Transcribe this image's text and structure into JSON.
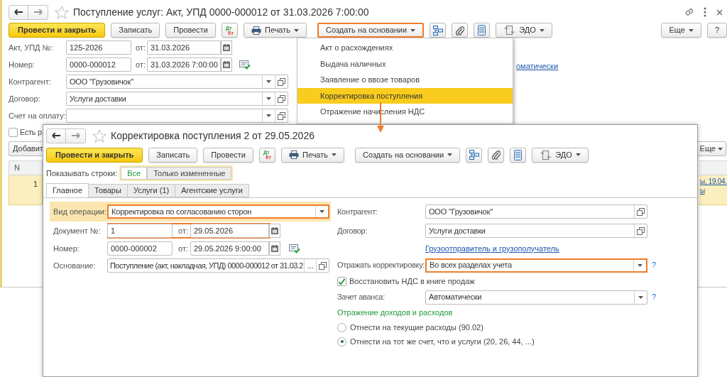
{
  "back_window": {
    "title": "Поступление услуг: Акт, УПД 0000-000012 от 31.03.2026 7:00:00",
    "toolbar": [
      {
        "kind": "primary",
        "label": "Провести и закрыть",
        "highlighted": false
      },
      {
        "kind": "button",
        "label": "Записать",
        "highlighted": false
      },
      {
        "kind": "button",
        "label": "Провести",
        "highlighted": false
      },
      {
        "kind": "dtkt",
        "top": "Дт",
        "bottom": "Кт",
        "highlighted": false
      },
      {
        "kind": "print",
        "label": "Печать",
        "highlighted": false
      },
      {
        "kind": "dropdown",
        "label": "Создать на основании",
        "highlighted": true
      },
      {
        "kind": "structure",
        "highlighted": false
      },
      {
        "kind": "attach",
        "highlighted": false
      },
      {
        "kind": "list",
        "highlighted": false
      },
      {
        "kind": "edo",
        "label": "ЭДО",
        "highlighted": false
      }
    ],
    "toolbar_right": [
      {
        "kind": "dropdown",
        "label": "Еще"
      },
      {
        "kind": "button",
        "label": "?"
      }
    ],
    "fields": [
      {
        "kind": "numbered",
        "label": "Акт, УПД №:",
        "value": "125-2026",
        "date_label": "от:",
        "date": "31.03.2026"
      },
      {
        "kind": "numbered_posted",
        "label": "Номер:",
        "value": "0000-000012",
        "date_label": "от:",
        "date": "31.03.2026  7:00:00"
      },
      {
        "kind": "select",
        "label": "Контрагент:",
        "value": "ООО \"Грузовичок\""
      },
      {
        "kind": "select",
        "label": "Договор:",
        "value": "Услуги доставки"
      },
      {
        "kind": "select",
        "label": "Счет на оплату:"
      }
    ],
    "link_fragment": "оматически",
    "checkbox": {
      "label": "Есть р",
      "checked": false
    },
    "table_toolbar": {
      "add": "Добавит",
      "more": "Еще"
    },
    "table": {
      "columns": [
        "N"
      ],
      "rows": [
        {
          "n": "1",
          "links": [
            "ы, 19.04.",
            "ы"
          ],
          "selected": true
        }
      ]
    },
    "menu": {
      "items": [
        {
          "label": "Акт о расхождениях",
          "selected": false
        },
        {
          "label": "Выдача наличных",
          "selected": false
        },
        {
          "label": "Заявление о ввозе товаров",
          "selected": false
        },
        {
          "label": "Корректировка поступления",
          "selected": true
        },
        {
          "label": "Отражение начисления НДС",
          "selected": false
        }
      ]
    }
  },
  "front_window": {
    "title": "Корректировка поступления 2 от 29.05.2026",
    "toolbar": [
      {
        "kind": "primary",
        "label": "Провести и закрыть"
      },
      {
        "kind": "button",
        "label": "Записать"
      },
      {
        "kind": "button",
        "label": "Провести"
      },
      {
        "kind": "dtkt",
        "top": "Дт",
        "bottom": "Кт"
      },
      {
        "kind": "print",
        "label": "Печать"
      },
      {
        "kind": "dropdown",
        "label": "Создать на основании"
      },
      {
        "kind": "structure"
      },
      {
        "kind": "attach"
      },
      {
        "kind": "list"
      },
      {
        "kind": "edo",
        "label": "ЭДО"
      }
    ],
    "row_filter": {
      "label": "Показывать строки:",
      "options": [
        {
          "label": "Все",
          "selected": true
        },
        {
          "label": "Только измененные",
          "selected": false
        }
      ]
    },
    "tabs": [
      {
        "label": "Главное",
        "selected": true
      },
      {
        "label": "Товары",
        "selected": false
      },
      {
        "label": "Услуги (1)",
        "selected": false
      },
      {
        "label": "Агентские услуги",
        "selected": false
      }
    ],
    "left_fields": [
      {
        "kind": "combo",
        "label": "Вид операции:",
        "value": "Корректировка по согласованию сторон",
        "highlighted": true,
        "attention": true
      },
      {
        "kind": "numbered",
        "label": "Документ №:",
        "value": "1",
        "date_label": "от:",
        "date": "29.05.2026",
        "highlighted": true,
        "attention": false
      },
      {
        "kind": "numbered_posted",
        "label": "Номер:",
        "value": "0000-000002",
        "date_label": "от:",
        "date": "29.05.2026  9:00:00",
        "highlighted": false,
        "attention": false
      },
      {
        "kind": "basis",
        "label": "Основание:",
        "value": "Поступление (акт, накладная, УПД) 0000-000012 от 31.03.2",
        "choice_text": "...",
        "highlighted": false,
        "attention": false
      }
    ],
    "right_fields": [
      {
        "kind": "reference",
        "label": "Контрагент:",
        "value": "ООО \"Грузовичок\"",
        "highlighted": false
      },
      {
        "kind": "reference",
        "label": "Договор:",
        "value": "Услуги доставки",
        "highlighted": false
      },
      {
        "kind": "link",
        "label": "Грузоотправитель и грузополучатель"
      },
      {
        "kind": "combo",
        "label": "Отражать корректировку:",
        "value": "Во всех разделах учета",
        "help": "?",
        "highlighted": true
      },
      {
        "kind": "checkbox",
        "label": "Восстановить НДС в книге продаж",
        "checked": true
      },
      {
        "kind": "combo",
        "label": "Зачет аванса:",
        "value": "Автоматически",
        "help": "?",
        "highlighted": false
      },
      {
        "kind": "header",
        "label": "Отражение доходов и расходов"
      },
      {
        "kind": "radio",
        "label": "Отнести на текущие расходы (90.02)",
        "selected": false
      },
      {
        "kind": "radio",
        "label": "Отнести на тот же счет, что и услуги (20, 26, 44, ...)",
        "selected": true
      }
    ]
  }
}
